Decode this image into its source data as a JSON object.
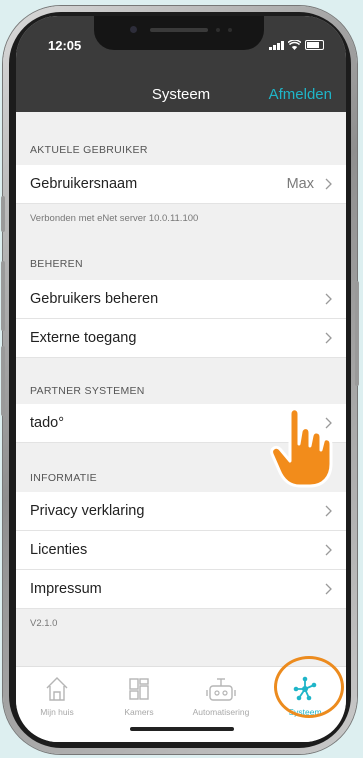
{
  "status_bar": {
    "time": "12:05"
  },
  "nav": {
    "title": "Systeem",
    "action": "Afmelden"
  },
  "sections": {
    "current_user": {
      "header": "AKTUELE GEBRUIKER",
      "rows": [
        {
          "label": "Gebruikersnaam",
          "value": "Max"
        }
      ],
      "footnote": "Verbonden met eNet server 10.0.11.100"
    },
    "manage": {
      "header": "BEHEREN",
      "rows": [
        {
          "label": "Gebruikers beheren"
        },
        {
          "label": "Externe toegang"
        }
      ]
    },
    "partner": {
      "header": "PARTNER SYSTEMEN",
      "rows": [
        {
          "label": "tado°"
        }
      ]
    },
    "info": {
      "header": "INFORMATIE",
      "rows": [
        {
          "label": "Privacy verklaring"
        },
        {
          "label": "Licenties"
        },
        {
          "label": "Impressum"
        }
      ]
    }
  },
  "version": "V2.1.0",
  "tabs": [
    {
      "label": "Mijn huis",
      "icon": "house-icon",
      "active": false
    },
    {
      "label": "Kamers",
      "icon": "rooms-icon",
      "active": false
    },
    {
      "label": "Automatisering",
      "icon": "robot-icon",
      "active": false
    },
    {
      "label": "Systeem",
      "icon": "network-icon",
      "active": true
    }
  ],
  "colors": {
    "accent": "#1fb5c8",
    "highlight": "#ec8b1e",
    "header_bg": "#3b3b3b"
  }
}
